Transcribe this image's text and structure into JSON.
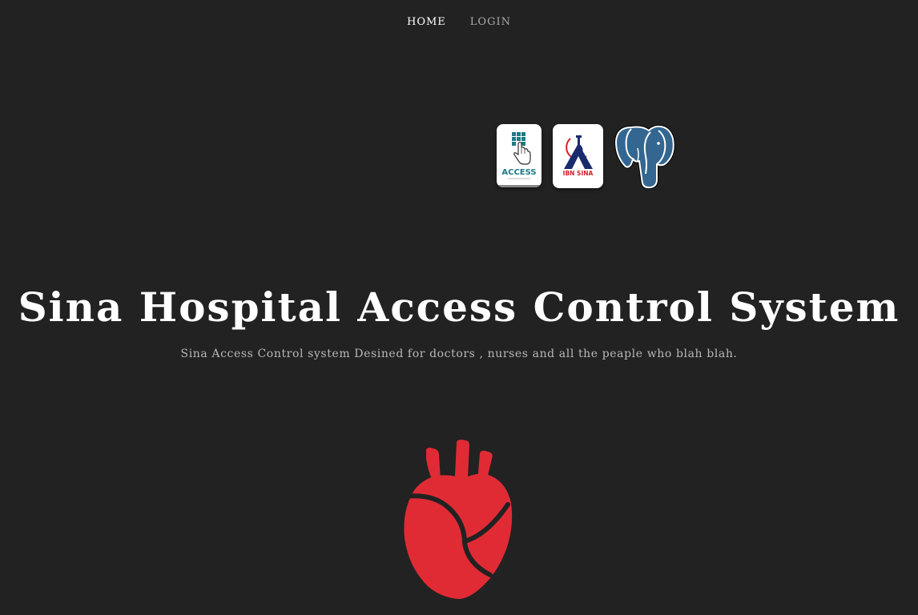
{
  "nav": {
    "items": [
      {
        "label": "HOME",
        "active": true
      },
      {
        "label": "LOGIN",
        "active": false
      }
    ]
  },
  "logos": {
    "access": {
      "text": "ACCESS",
      "icon": "keypad-hand-icon"
    },
    "sina": {
      "text": "IBN SINA",
      "icon": "microscope-icon"
    },
    "postgres": {
      "icon": "postgresql-elephant-icon"
    }
  },
  "hero": {
    "title": "Sina Hospital Access Control System",
    "subtitle": "Sina Access Control system Desined for doctors , nurses and all the peaple who blah blah."
  },
  "illustration": {
    "icon": "heart-icon",
    "color": "#e02b35"
  },
  "colors": {
    "background": "#222222",
    "title": "#ffffff",
    "subtitle": "#b8b8b8",
    "nav_active": "#ffffff",
    "nav_inactive": "#aaaaaa",
    "postgres_blue": "#336791"
  }
}
